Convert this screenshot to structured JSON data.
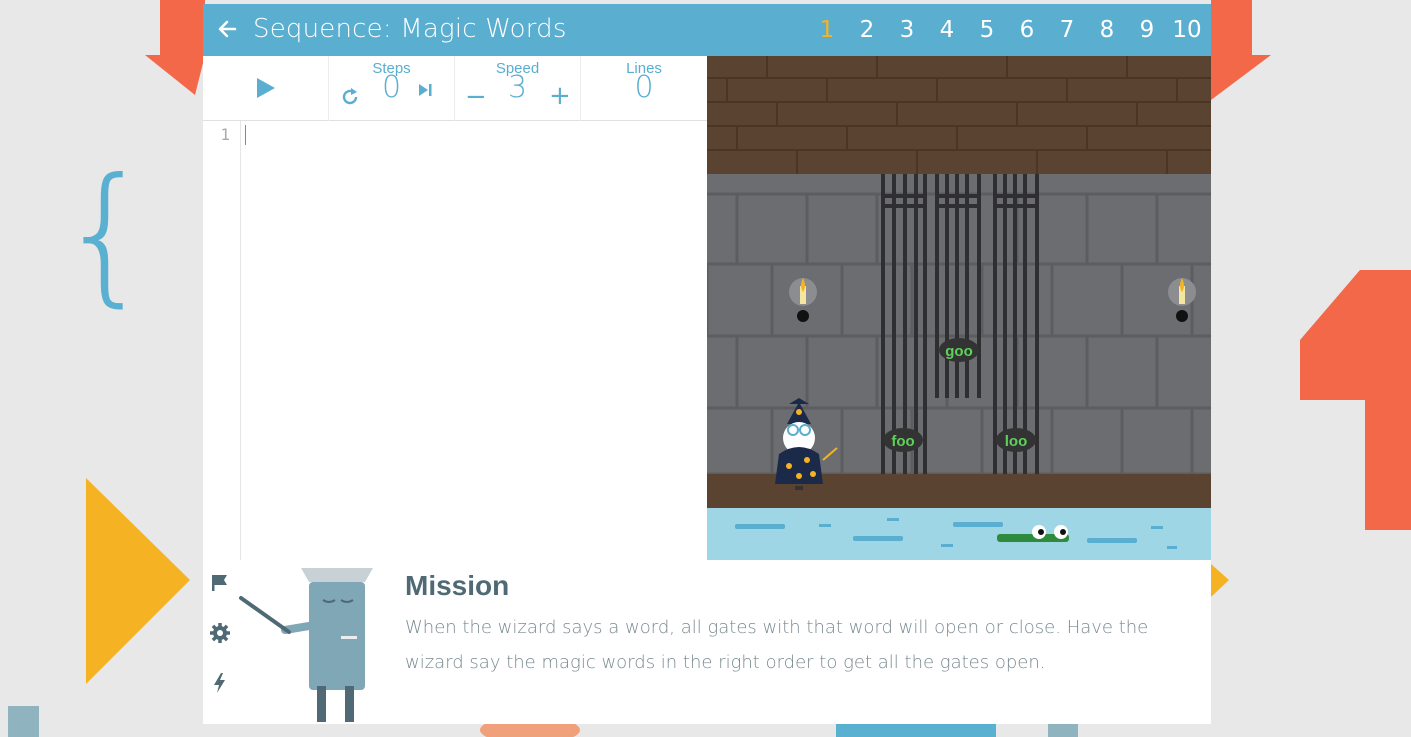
{
  "header": {
    "back_icon": "arrow-left-icon",
    "title": "Sequence: Magic Words",
    "levels": [
      "1",
      "2",
      "3",
      "4",
      "5",
      "6",
      "7",
      "8",
      "9",
      "10"
    ],
    "active_level": "1"
  },
  "toolbar": {
    "run_icon": "play-icon",
    "steps_label": "Steps",
    "steps_value": "0",
    "speed_label": "Speed",
    "speed_value": "3",
    "speed_minus": "−",
    "speed_plus": "+",
    "lines_label": "Lines",
    "lines_value": "0"
  },
  "editor": {
    "line_numbers": [
      "1"
    ]
  },
  "game": {
    "gate_words": [
      "foo",
      "goo",
      "loo"
    ]
  },
  "mission": {
    "title": "Mission",
    "text": "When the wizard says a word, all gates with that word will open or close. Have the wizard say the magic words in the right order to get all the gates open.",
    "side_icons": [
      "flag-icon",
      "gear-icon",
      "bolt-icon"
    ]
  },
  "colors": {
    "header": "#5aaed0",
    "active_level": "#f5b324",
    "mission_title": "#4f6a74"
  }
}
